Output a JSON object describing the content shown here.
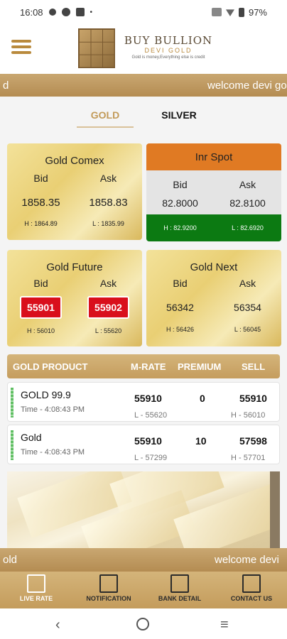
{
  "status": {
    "time": "16:08",
    "battery": "97%"
  },
  "brand": {
    "title": "BUY BULLION",
    "subtitle": "DEVI GOLD",
    "tagline": "Gold is money,Everything else is credit"
  },
  "marquee_top": {
    "left": "d",
    "right": "welcome devi go"
  },
  "tabs": {
    "gold": "GOLD",
    "silver": "SILVER"
  },
  "comex": {
    "title": "Gold Comex",
    "bid_label": "Bid",
    "ask_label": "Ask",
    "bid": "1858.35",
    "ask": "1858.83",
    "high": "H : 1864.89",
    "low": "L : 1835.99"
  },
  "inr": {
    "title": "Inr Spot",
    "bid_label": "Bid",
    "ask_label": "Ask",
    "bid": "82.8000",
    "ask": "82.8100",
    "high": "H : 82.9200",
    "low": "L : 82.6920"
  },
  "future": {
    "title": "Gold Future",
    "bid_label": "Bid",
    "ask_label": "Ask",
    "bid": "55901",
    "ask": "55902",
    "high": "H : 56010",
    "low": "L : 55620"
  },
  "next": {
    "title": "Gold Next",
    "bid_label": "Bid",
    "ask_label": "Ask",
    "bid": "56342",
    "ask": "56354",
    "high": "H : 56426",
    "low": "L : 56045"
  },
  "table": {
    "headers": [
      "GOLD PRODUCT",
      "M-RATE",
      "PREMIUM",
      "SELL"
    ]
  },
  "products": [
    {
      "name": "GOLD 99.9",
      "time": "Time - 4:08:43 PM",
      "mrate": "55910",
      "premium": "0",
      "sell": "55910",
      "low": "L - 55620",
      "high": "H - 56010"
    },
    {
      "name": "Gold",
      "time": "Time - 4:08:43 PM",
      "mrate": "55910",
      "premium": "10",
      "sell": "57598",
      "low": "L - 57299",
      "high": "H - 57701"
    }
  ],
  "marquee_bottom": {
    "left": "old",
    "right": "welcome devi "
  },
  "nav": {
    "live": "LIVE RATE",
    "notification": "NOTIFICATION",
    "bank": "BANK DETAIL",
    "contact": "CONTACT US"
  },
  "colors": {
    "gold_accent": "#c29a58",
    "inr_header": "#e07a23",
    "inr_footer": "#0c7a12",
    "price_red": "#d90f1c"
  }
}
